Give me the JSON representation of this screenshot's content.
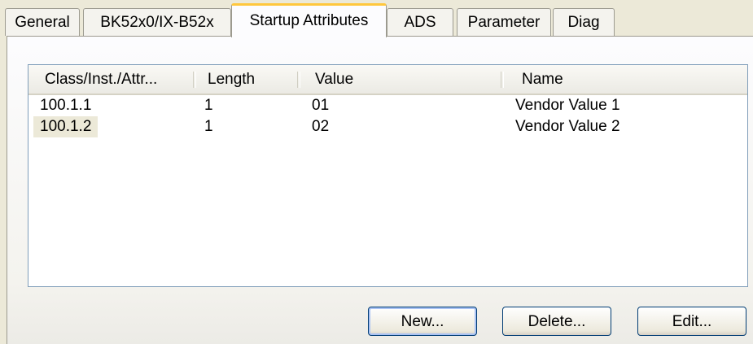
{
  "tabs": [
    {
      "label": "General"
    },
    {
      "label": "BK52x0/IX-B52x"
    },
    {
      "label": "Startup Attributes"
    },
    {
      "label": "ADS"
    },
    {
      "label": "Parameter"
    },
    {
      "label": "Diag"
    }
  ],
  "list": {
    "columns": [
      "Class/Inst./Attr...",
      "Length",
      "Value",
      "Name"
    ],
    "rows": [
      [
        "100.1.1",
        "1",
        "01",
        "Vendor Value 1"
      ],
      [
        "100.1.2",
        "1",
        "02",
        "Vendor Value 2"
      ]
    ]
  },
  "buttons": {
    "new": "New...",
    "delete": "Delete...",
    "edit": "Edit..."
  }
}
